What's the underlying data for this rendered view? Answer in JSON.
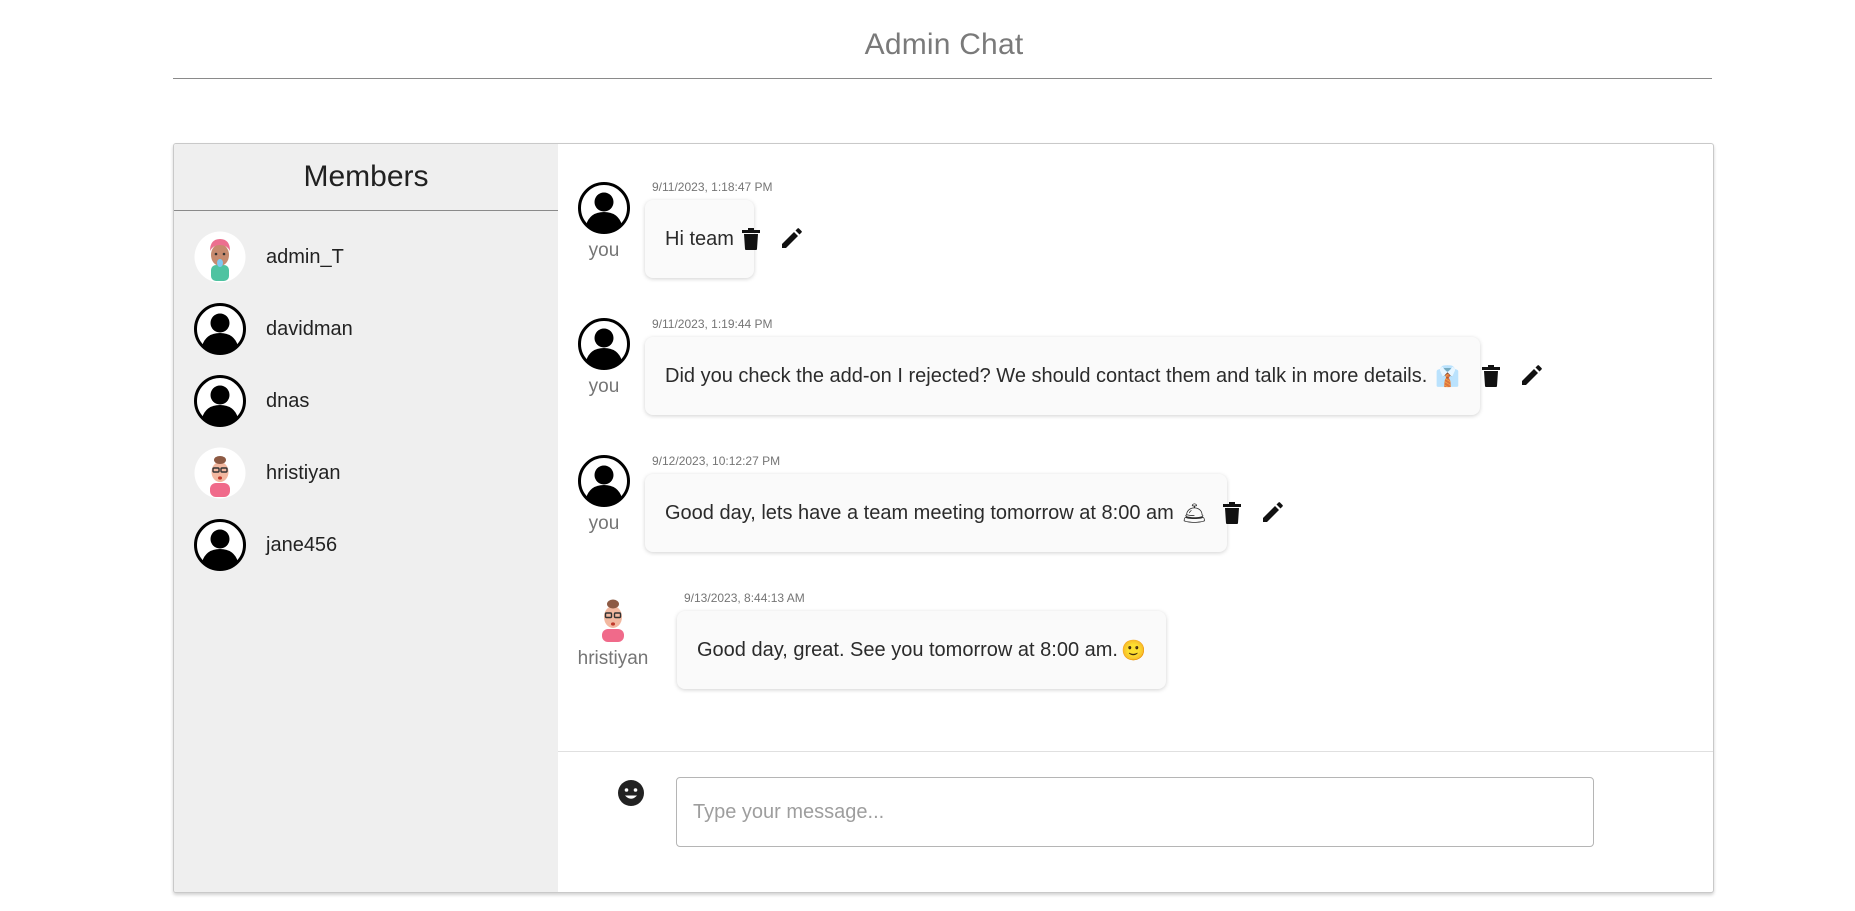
{
  "header": {
    "title": "Admin Chat"
  },
  "sidebar": {
    "heading": "Members",
    "members": [
      {
        "name": "admin_T",
        "avatar": "cartoon-avatar-pink-hair"
      },
      {
        "name": "davidman",
        "avatar": "default-user-silhouette"
      },
      {
        "name": "dnas",
        "avatar": "default-user-silhouette"
      },
      {
        "name": "hristiyan",
        "avatar": "cartoon-avatar-glasses"
      },
      {
        "name": "jane456",
        "avatar": "default-user-silhouette"
      }
    ]
  },
  "messages": [
    {
      "sender": "you",
      "avatar": "default-user-silhouette",
      "timestamp": "9/11/2023, 1:18:47 PM",
      "text": "Hi team",
      "emoji": "",
      "own": true
    },
    {
      "sender": "you",
      "avatar": "default-user-silhouette",
      "timestamp": "9/11/2023, 1:19:44 PM",
      "text": "Did you check the add-on I rejected? We should contact them and talk in more details.",
      "emoji": "👔",
      "own": true
    },
    {
      "sender": "you",
      "avatar": "default-user-silhouette",
      "timestamp": "9/12/2023, 10:12:27 PM",
      "text": "Good day, lets have a team meeting tomorrow at 8:00 am",
      "emoji": "🛎",
      "own": true
    },
    {
      "sender": "hristiyan",
      "avatar": "cartoon-avatar-glasses",
      "timestamp": "9/13/2023, 8:44:13 AM",
      "text": "Good day, great. See you tomorrow at 8:00 am.",
      "emoji": "🙂",
      "own": false
    }
  ],
  "composer": {
    "placeholder": "Type your message...",
    "value": ""
  },
  "icons": {
    "delete": "trash-icon",
    "edit": "pencil-icon",
    "emoji": "smiley-icon"
  },
  "colors": {
    "sidebar_bg": "#efefef",
    "bubble_bg": "#fafafa",
    "muted_text": "#757575"
  }
}
